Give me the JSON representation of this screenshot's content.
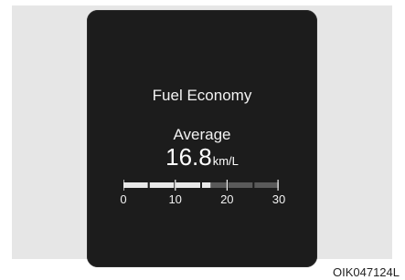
{
  "screen": {
    "title": "Fuel Economy",
    "mode_label": "Average",
    "value": "16.8",
    "unit": "km/L"
  },
  "gauge": {
    "min": 0,
    "max": 30,
    "current": 16.8,
    "scale_labels": [
      "0",
      "10",
      "20",
      "30"
    ],
    "fill_color": "#e8e8e8",
    "track_color": "#5a5a5a"
  },
  "figure_code": "OIK047124L"
}
